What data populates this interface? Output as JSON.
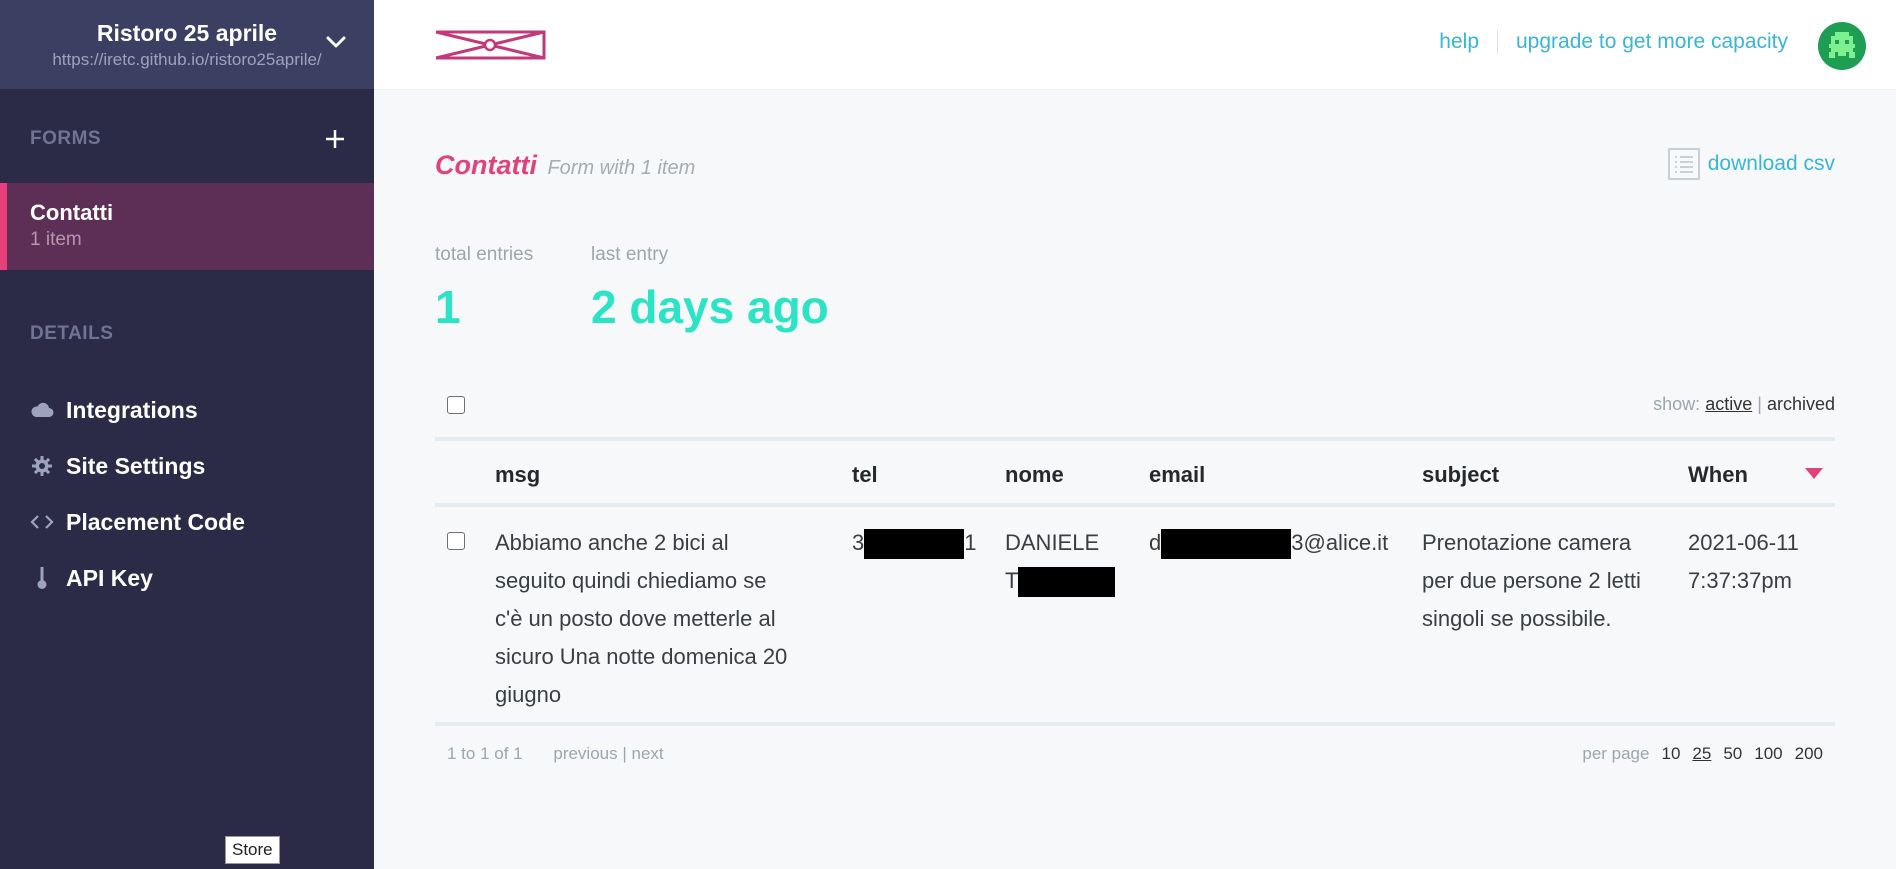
{
  "site": {
    "name": "Ristoro 25 aprile",
    "url": "https://iretc.github.io/ristoro25aprile/"
  },
  "sidebar": {
    "forms_label": "FORMS",
    "details_label": "DETAILS",
    "active_form": {
      "name": "Contatti",
      "count": "1 item"
    },
    "nav": [
      {
        "label": "Integrations",
        "icon": "cloud-icon"
      },
      {
        "label": "Site Settings",
        "icon": "gear-icon"
      },
      {
        "label": "Placement Code",
        "icon": "code-icon"
      },
      {
        "label": "API Key",
        "icon": "key-icon"
      }
    ],
    "tooltip": "Store"
  },
  "topbar": {
    "help_label": "help",
    "upgrade_label": "upgrade to get more capacity"
  },
  "form": {
    "title": "Contatti",
    "subtitle": "Form with 1 item",
    "download_label": "download csv"
  },
  "stats": {
    "total_label": "total entries",
    "total_value": "1",
    "last_label": "last entry",
    "last_value": "2 days ago"
  },
  "show": {
    "prefix": "show:",
    "active": "active",
    "sep": "|",
    "archived": "archived"
  },
  "table": {
    "headers": [
      "msg",
      "tel",
      "nome",
      "email",
      "subject",
      "When"
    ],
    "row": {
      "msg_lines": [
        "Abbiamo anche 2 bici al",
        "seguito quindi chiediamo se",
        "c'è un posto dove metterle al",
        "sicuro Una notte domenica 20",
        "giugno"
      ],
      "tel_prefix": "3",
      "tel_suffix": "1",
      "nome_line1": "DANIELE",
      "nome_prefix": "T",
      "email_prefix": "d",
      "email_suffix": "3@alice.it",
      "subject_lines": [
        "Prenotazione camera",
        "per due persone 2 letti",
        "singoli se possibile."
      ],
      "when_date": "2021-06-11",
      "when_time": "7:37:37pm"
    }
  },
  "pager": {
    "range": "1 to 1 of 1",
    "previous": "previous",
    "sep": "|",
    "next": "next",
    "per_page_label": "per page",
    "options": [
      "10",
      "25",
      "50",
      "100",
      "200"
    ],
    "selected": "25"
  },
  "colors": {
    "sidebar_bg": "#2b2b47",
    "accent_pink": "#e0427d",
    "accent_teal": "#2de3c6",
    "link_blue": "#38b6d4"
  }
}
